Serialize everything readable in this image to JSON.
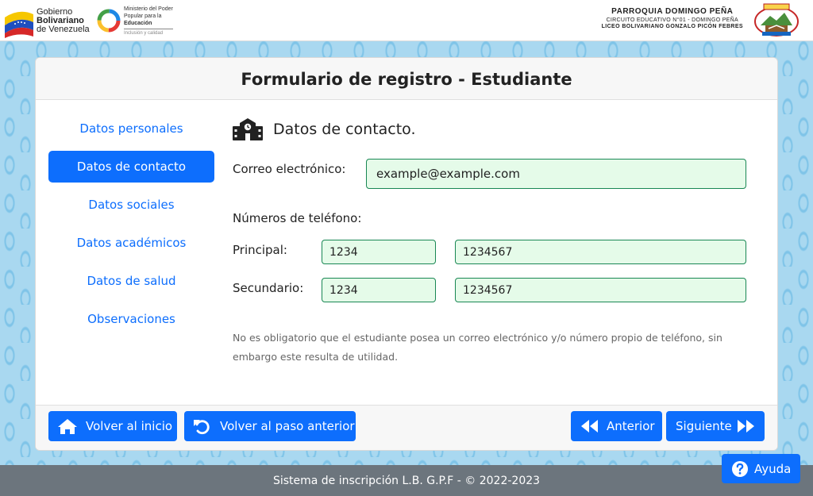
{
  "header": {
    "gov_logo": {
      "line1": "Gobierno",
      "line2": "Bolivariano",
      "line3": "de Venezuela"
    },
    "ministry_logo": {
      "line1": "Ministerio del Poder",
      "line2": "Popular para la",
      "line3": "Educación",
      "tagline": "Inclusión y calidad"
    },
    "institution": {
      "parish": "PARROQUIA DOMINGO PEÑA",
      "circuit": "CIRCUITO EDUCATIVO N°01 - DOMINGO PEÑA",
      "school": "LICEO BOLIVARIANO GONZALO PICÓN FEBRES"
    }
  },
  "form": {
    "title": "Formulario de registro - Estudiante",
    "nav": [
      {
        "label": "Datos personales",
        "active": false
      },
      {
        "label": "Datos de contacto",
        "active": true
      },
      {
        "label": "Datos sociales",
        "active": false
      },
      {
        "label": "Datos académicos",
        "active": false
      },
      {
        "label": "Datos de salud",
        "active": false
      },
      {
        "label": "Observaciones",
        "active": false
      }
    ],
    "section": {
      "icon": "school-icon",
      "title": "Datos de contacto."
    },
    "email": {
      "label": "Correo electrónico:",
      "value": "example@example.com"
    },
    "phones": {
      "heading": "Números de teléfono:",
      "primary": {
        "label": "Principal:",
        "code": "1234",
        "number": "1234567"
      },
      "secondary": {
        "label": "Secundario:",
        "code": "1234",
        "number": "1234567"
      }
    },
    "help_text": "No es obligatorio que el estudiante posea un correo electrónico y/o número propio de teléfono, sin embargo este resulta de utilidad.",
    "buttons": {
      "home": {
        "label": "Volver al inicio",
        "icon": "home-icon"
      },
      "back_step": {
        "label": "Volver al paso anterior",
        "icon": "undo-icon"
      },
      "previous": {
        "label": "Anterior",
        "icon": "backward-icon"
      },
      "next": {
        "label": "Siguiente",
        "icon": "forward-icon"
      }
    }
  },
  "footer": {
    "text": "Sistema de inscripción L.B. G.P.F - © 2022-2023"
  },
  "help_button": {
    "label": "Ayuda",
    "icon": "question-circle-icon"
  },
  "colors": {
    "primary": "#0d6efd",
    "valid_border": "#198754",
    "valid_bg": "#e5fbe9",
    "footer_bg": "#6c757d"
  }
}
